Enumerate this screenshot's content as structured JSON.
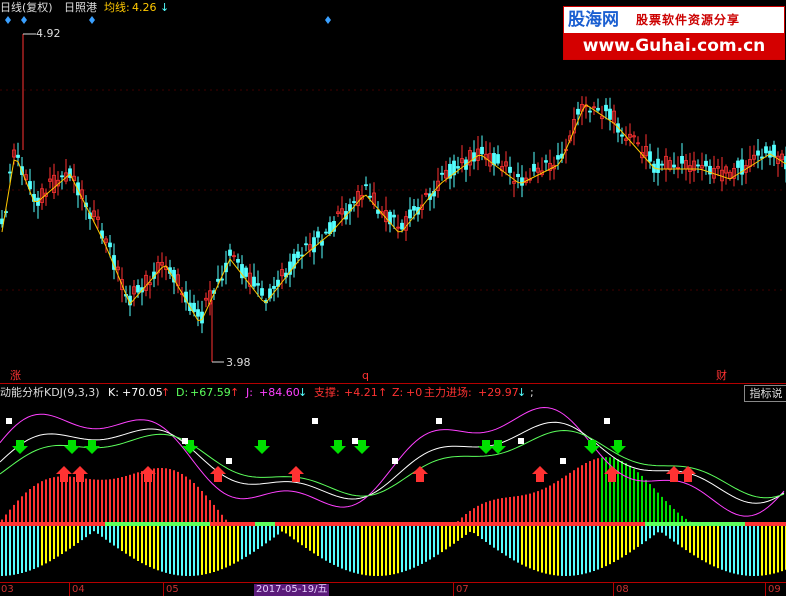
{
  "header": {
    "chart_label": "日线(复权)",
    "stock_name": "日照港",
    "ma_label": "均线:",
    "ma_value": "4.26",
    "ma_arrow": "↓"
  },
  "price_panel": {
    "high_label": "4.92",
    "low_label": "3.98",
    "marker_zhang": "涨",
    "marker_q": "q",
    "marker_cai": "财"
  },
  "indicator_bar": {
    "title": "动能分析KDJ(9,3,3)",
    "k_label": "K:",
    "k_value": "+70.05",
    "k_arrow": "↑",
    "d_label": "D:",
    "d_value": "+67.59",
    "d_arrow": "↑",
    "j_label": "J:",
    "j_value": "+84.60",
    "j_arrow": "↓",
    "support_label": "支撑:",
    "support_value": "+4.21",
    "support_arrow": "↑",
    "z_label": "Z:",
    "z_value": "+0",
    "main_label": "主力进场:",
    "main_value": "+29.97",
    "main_arrow": "↓",
    "tail": ";"
  },
  "indicator_button": "指标说",
  "watermark": {
    "logo": "股海网",
    "slogan": "股票软件资源分享",
    "url": "www.Guhai.com.cn"
  },
  "x_axis": {
    "ticks": [
      "03",
      "04",
      "05",
      "2017-05-19/五",
      "07",
      "08",
      "09"
    ]
  },
  "colors": {
    "up": "#ff3232",
    "down": "#54ffff",
    "ma": "#ffc800",
    "k_line": "#ffffff",
    "d_line": "#ffff00",
    "j_line": "#ff40ff",
    "green_bars": "#00e000",
    "kdj_green": "#5cff5c",
    "grid": "#b40000"
  },
  "chart_data": {
    "type": "candlestick",
    "title": "",
    "symbol": "日照港",
    "y_markers": {
      "high": 4.92,
      "low": 3.98
    },
    "ma_current": 4.26
  }
}
